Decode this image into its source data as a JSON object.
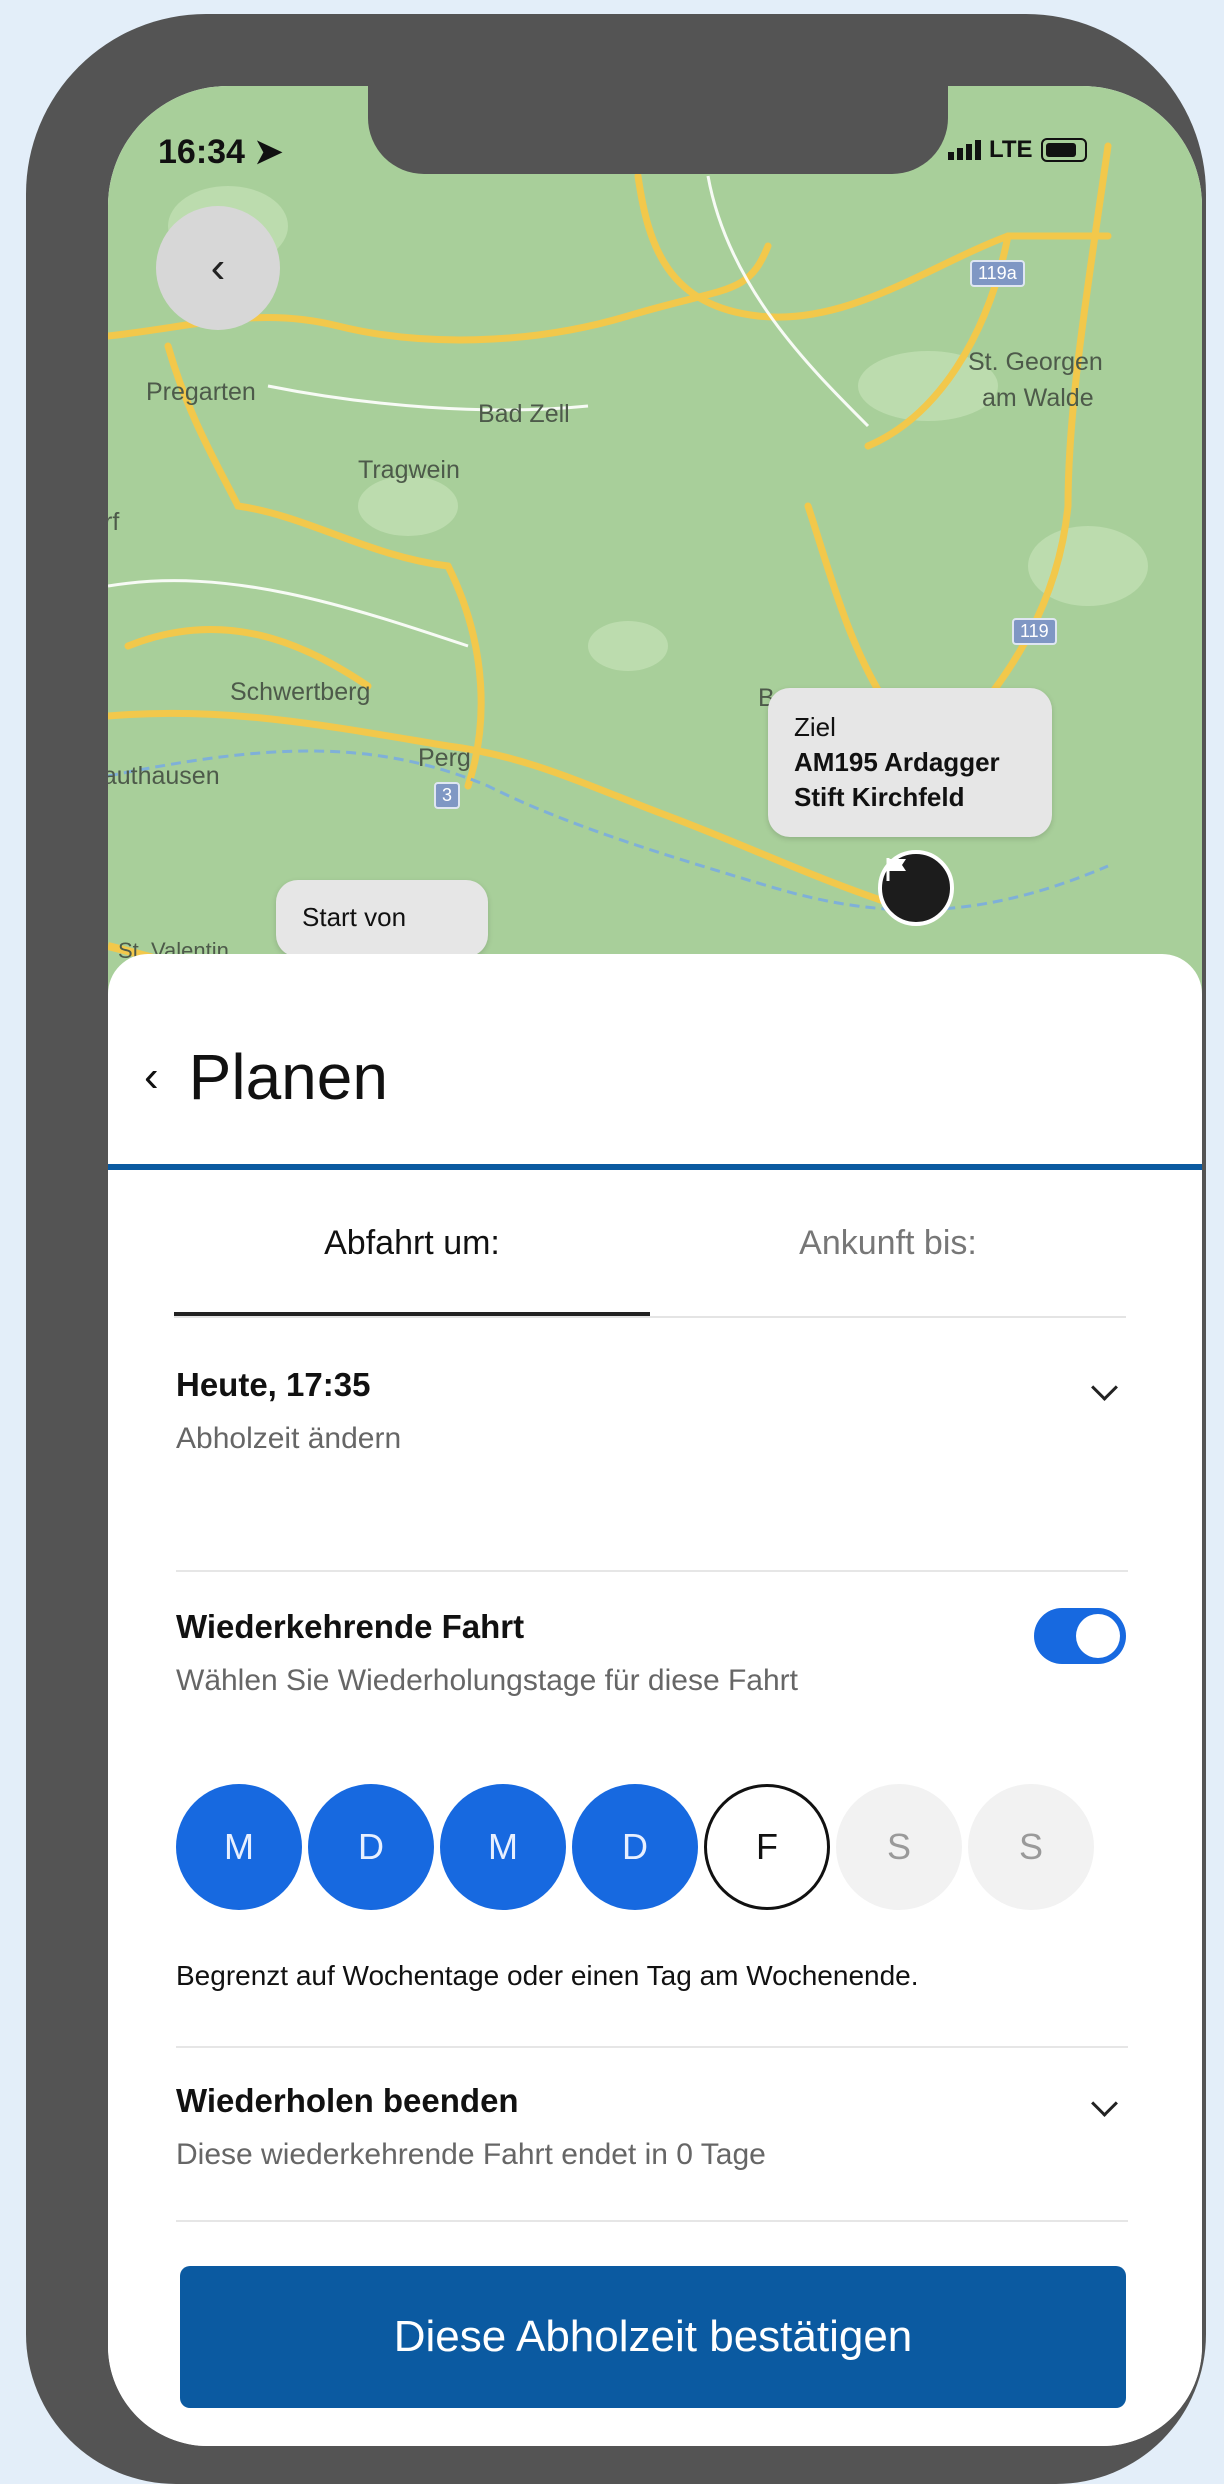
{
  "status_bar": {
    "time": "16:34",
    "network": "LTE"
  },
  "map": {
    "towns": [
      "Pregarten",
      "Bad Zell",
      "Tragwein",
      "St. Georgen",
      "am Walde",
      "Schwertberg",
      "Bad Kreuzen",
      "Perg",
      "Mauthausen",
      "rf",
      "St. Valentin"
    ],
    "road_shields": [
      "119a",
      "119",
      "3"
    ],
    "destination_bubble": {
      "label": "Ziel",
      "name_line1": "AM195 Ardagger",
      "name_line2": "Stift Kirchfeld"
    },
    "start_bubble": {
      "label": "Start von"
    }
  },
  "sheet": {
    "title": "Planen",
    "tabs": [
      {
        "label": "Abfahrt um:",
        "active": true
      },
      {
        "label": "Ankunft bis:",
        "active": false
      }
    ],
    "pickup": {
      "title": "Heute, 17:35",
      "subtitle": "Abholzeit ändern"
    },
    "recurring": {
      "title": "Wiederkehrende Fahrt",
      "subtitle": "Wählen Sie Wiederholungstage für diese Fahrt",
      "toggle_on": true,
      "days": [
        {
          "label": "M",
          "state": "selected"
        },
        {
          "label": "D",
          "state": "selected"
        },
        {
          "label": "M",
          "state": "selected"
        },
        {
          "label": "D",
          "state": "selected"
        },
        {
          "label": "F",
          "state": "outlined"
        },
        {
          "label": "S",
          "state": "disabled"
        },
        {
          "label": "S",
          "state": "disabled"
        }
      ],
      "note": "Begrenzt auf Wochentage oder einen Tag am Wochenende."
    },
    "end_repeat": {
      "title": "Wiederholen beenden",
      "subtitle": "Diese wiederkehrende Fahrt endet in 0 Tage"
    },
    "confirm_label": "Diese Abholzeit bestätigen"
  },
  "colors": {
    "primary": "#0b5aa1",
    "accent": "#1769e0",
    "map_green": "#a8cf9a",
    "road_yellow": "#f2c84b"
  }
}
